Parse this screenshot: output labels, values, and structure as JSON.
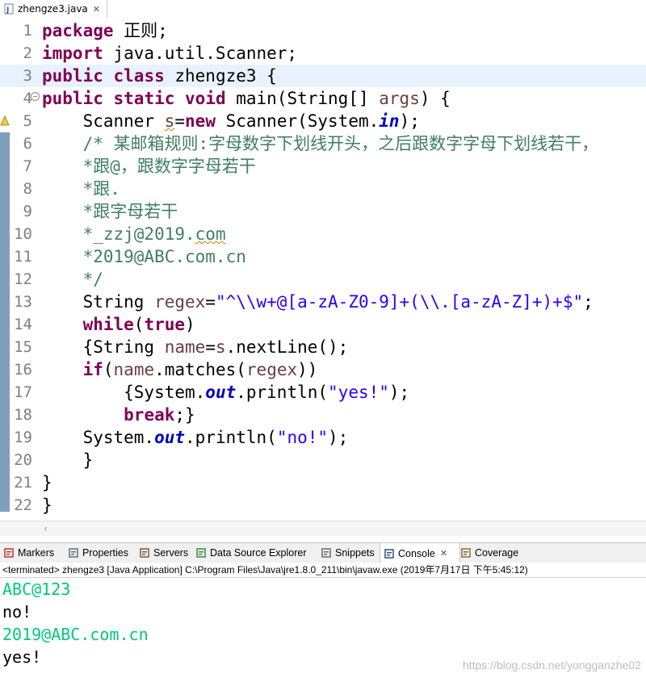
{
  "editor_tab": {
    "filename": "zhengze3.java"
  },
  "code_lines": [
    {
      "n": "1",
      "tokens": [
        {
          "t": "package",
          "c": "kw"
        },
        {
          "t": " 正则;",
          "c": ""
        }
      ]
    },
    {
      "n": "2",
      "tokens": [
        {
          "t": "import",
          "c": "kw"
        },
        {
          "t": " java.util.Scanner;",
          "c": ""
        }
      ]
    },
    {
      "n": "3",
      "tokens": [
        {
          "t": "public",
          "c": "kw"
        },
        {
          "t": " ",
          "c": ""
        },
        {
          "t": "class",
          "c": "kw"
        },
        {
          "t": " zhengze3 {",
          "c": ""
        }
      ]
    },
    {
      "n": "4",
      "tokens": [
        {
          "t": "public",
          "c": "kw"
        },
        {
          "t": " ",
          "c": ""
        },
        {
          "t": "static",
          "c": "kw"
        },
        {
          "t": " ",
          "c": ""
        },
        {
          "t": "void",
          "c": "kw"
        },
        {
          "t": " main(String[] ",
          "c": ""
        },
        {
          "t": "args",
          "c": "var"
        },
        {
          "t": ") {",
          "c": ""
        }
      ]
    },
    {
      "n": "5",
      "tokens": [
        {
          "t": "    Scanner ",
          "c": ""
        },
        {
          "t": "s",
          "c": "var warn"
        },
        {
          "t": "=",
          "c": ""
        },
        {
          "t": "new",
          "c": "kw"
        },
        {
          "t": " Scanner(System.",
          "c": ""
        },
        {
          "t": "in",
          "c": "stat"
        },
        {
          "t": ");",
          "c": ""
        }
      ]
    },
    {
      "n": "6",
      "tokens": [
        {
          "t": "    /* 某邮箱规则:字母数字下划线开头，之后跟数字字母下划线若干，",
          "c": "cm"
        }
      ]
    },
    {
      "n": "7",
      "tokens": [
        {
          "t": "    *跟@，跟数字字母若干",
          "c": "cm"
        }
      ]
    },
    {
      "n": "8",
      "tokens": [
        {
          "t": "    *跟.",
          "c": "cm"
        }
      ]
    },
    {
      "n": "9",
      "tokens": [
        {
          "t": "    *跟字母若干",
          "c": "cm"
        }
      ]
    },
    {
      "n": "10",
      "tokens": [
        {
          "t": "    *_zzj@2019.",
          "c": "cm"
        },
        {
          "t": "com",
          "c": "cm warn"
        }
      ]
    },
    {
      "n": "11",
      "tokens": [
        {
          "t": "    *2019@ABC.com.cn",
          "c": "cm"
        }
      ]
    },
    {
      "n": "12",
      "tokens": [
        {
          "t": "    */",
          "c": "cm"
        }
      ]
    },
    {
      "n": "13",
      "tokens": [
        {
          "t": "    String ",
          "c": ""
        },
        {
          "t": "regex",
          "c": "var"
        },
        {
          "t": "=",
          "c": ""
        },
        {
          "t": "\"^\\\\w+@[a-zA-Z0-9]+(\\\\.[a-zA-Z]+)+$\"",
          "c": "str"
        },
        {
          "t": ";",
          "c": ""
        }
      ]
    },
    {
      "n": "14",
      "tokens": [
        {
          "t": "    ",
          "c": ""
        },
        {
          "t": "while",
          "c": "kw"
        },
        {
          "t": "(",
          "c": ""
        },
        {
          "t": "true",
          "c": "kw"
        },
        {
          "t": ")",
          "c": ""
        }
      ]
    },
    {
      "n": "15",
      "tokens": [
        {
          "t": "    {String ",
          "c": ""
        },
        {
          "t": "name",
          "c": "var"
        },
        {
          "t": "=",
          "c": ""
        },
        {
          "t": "s",
          "c": "var"
        },
        {
          "t": ".nextLine();",
          "c": ""
        }
      ]
    },
    {
      "n": "16",
      "tokens": [
        {
          "t": "    ",
          "c": ""
        },
        {
          "t": "if",
          "c": "kw"
        },
        {
          "t": "(",
          "c": ""
        },
        {
          "t": "name",
          "c": "var"
        },
        {
          "t": ".matches(",
          "c": ""
        },
        {
          "t": "regex",
          "c": "var"
        },
        {
          "t": "))",
          "c": ""
        }
      ]
    },
    {
      "n": "17",
      "tokens": [
        {
          "t": "        {System.",
          "c": ""
        },
        {
          "t": "out",
          "c": "stat"
        },
        {
          "t": ".println(",
          "c": ""
        },
        {
          "t": "\"yes!\"",
          "c": "str"
        },
        {
          "t": ");",
          "c": ""
        }
      ]
    },
    {
      "n": "18",
      "tokens": [
        {
          "t": "        ",
          "c": ""
        },
        {
          "t": "break",
          "c": "kw"
        },
        {
          "t": ";}",
          "c": ""
        }
      ]
    },
    {
      "n": "19",
      "tokens": [
        {
          "t": "    System.",
          "c": ""
        },
        {
          "t": "out",
          "c": "stat"
        },
        {
          "t": ".println(",
          "c": ""
        },
        {
          "t": "\"no!\"",
          "c": "str"
        },
        {
          "t": ");",
          "c": ""
        }
      ]
    },
    {
      "n": "20",
      "tokens": [
        {
          "t": "    }",
          "c": ""
        }
      ]
    },
    {
      "n": "21",
      "tokens": [
        {
          "t": "}",
          "c": ""
        }
      ]
    },
    {
      "n": "22",
      "tokens": [
        {
          "t": "}",
          "c": ""
        }
      ]
    }
  ],
  "current_line": 3,
  "panel_tabs": [
    {
      "label": "Markers",
      "icon": "markers-icon"
    },
    {
      "label": "Properties",
      "icon": "properties-icon"
    },
    {
      "label": "Servers",
      "icon": "servers-icon"
    },
    {
      "label": "Data Source Explorer",
      "icon": "data-source-icon"
    },
    {
      "label": "Snippets",
      "icon": "snippets-icon"
    },
    {
      "label": "Console",
      "icon": "console-icon",
      "active": true
    },
    {
      "label": "Coverage",
      "icon": "coverage-icon"
    }
  ],
  "console": {
    "header": "<terminated> zhengze3 [Java Application] C:\\Program Files\\Java\\jre1.8.0_211\\bin\\javaw.exe (2019年7月17日 下午5:45:12)",
    "lines": [
      {
        "text": "ABC@123",
        "kind": "in"
      },
      {
        "text": "no!",
        "kind": "out"
      },
      {
        "text": "2019@ABC.com.cn",
        "kind": "in"
      },
      {
        "text": "yes!",
        "kind": "out"
      }
    ]
  },
  "watermark": "https://blog.csdn.net/yongganzhe02",
  "colors": {
    "keyword": "#7f0055",
    "string": "#2a00ff",
    "comment": "#3f7f5f",
    "stdin": "#00c87d"
  }
}
